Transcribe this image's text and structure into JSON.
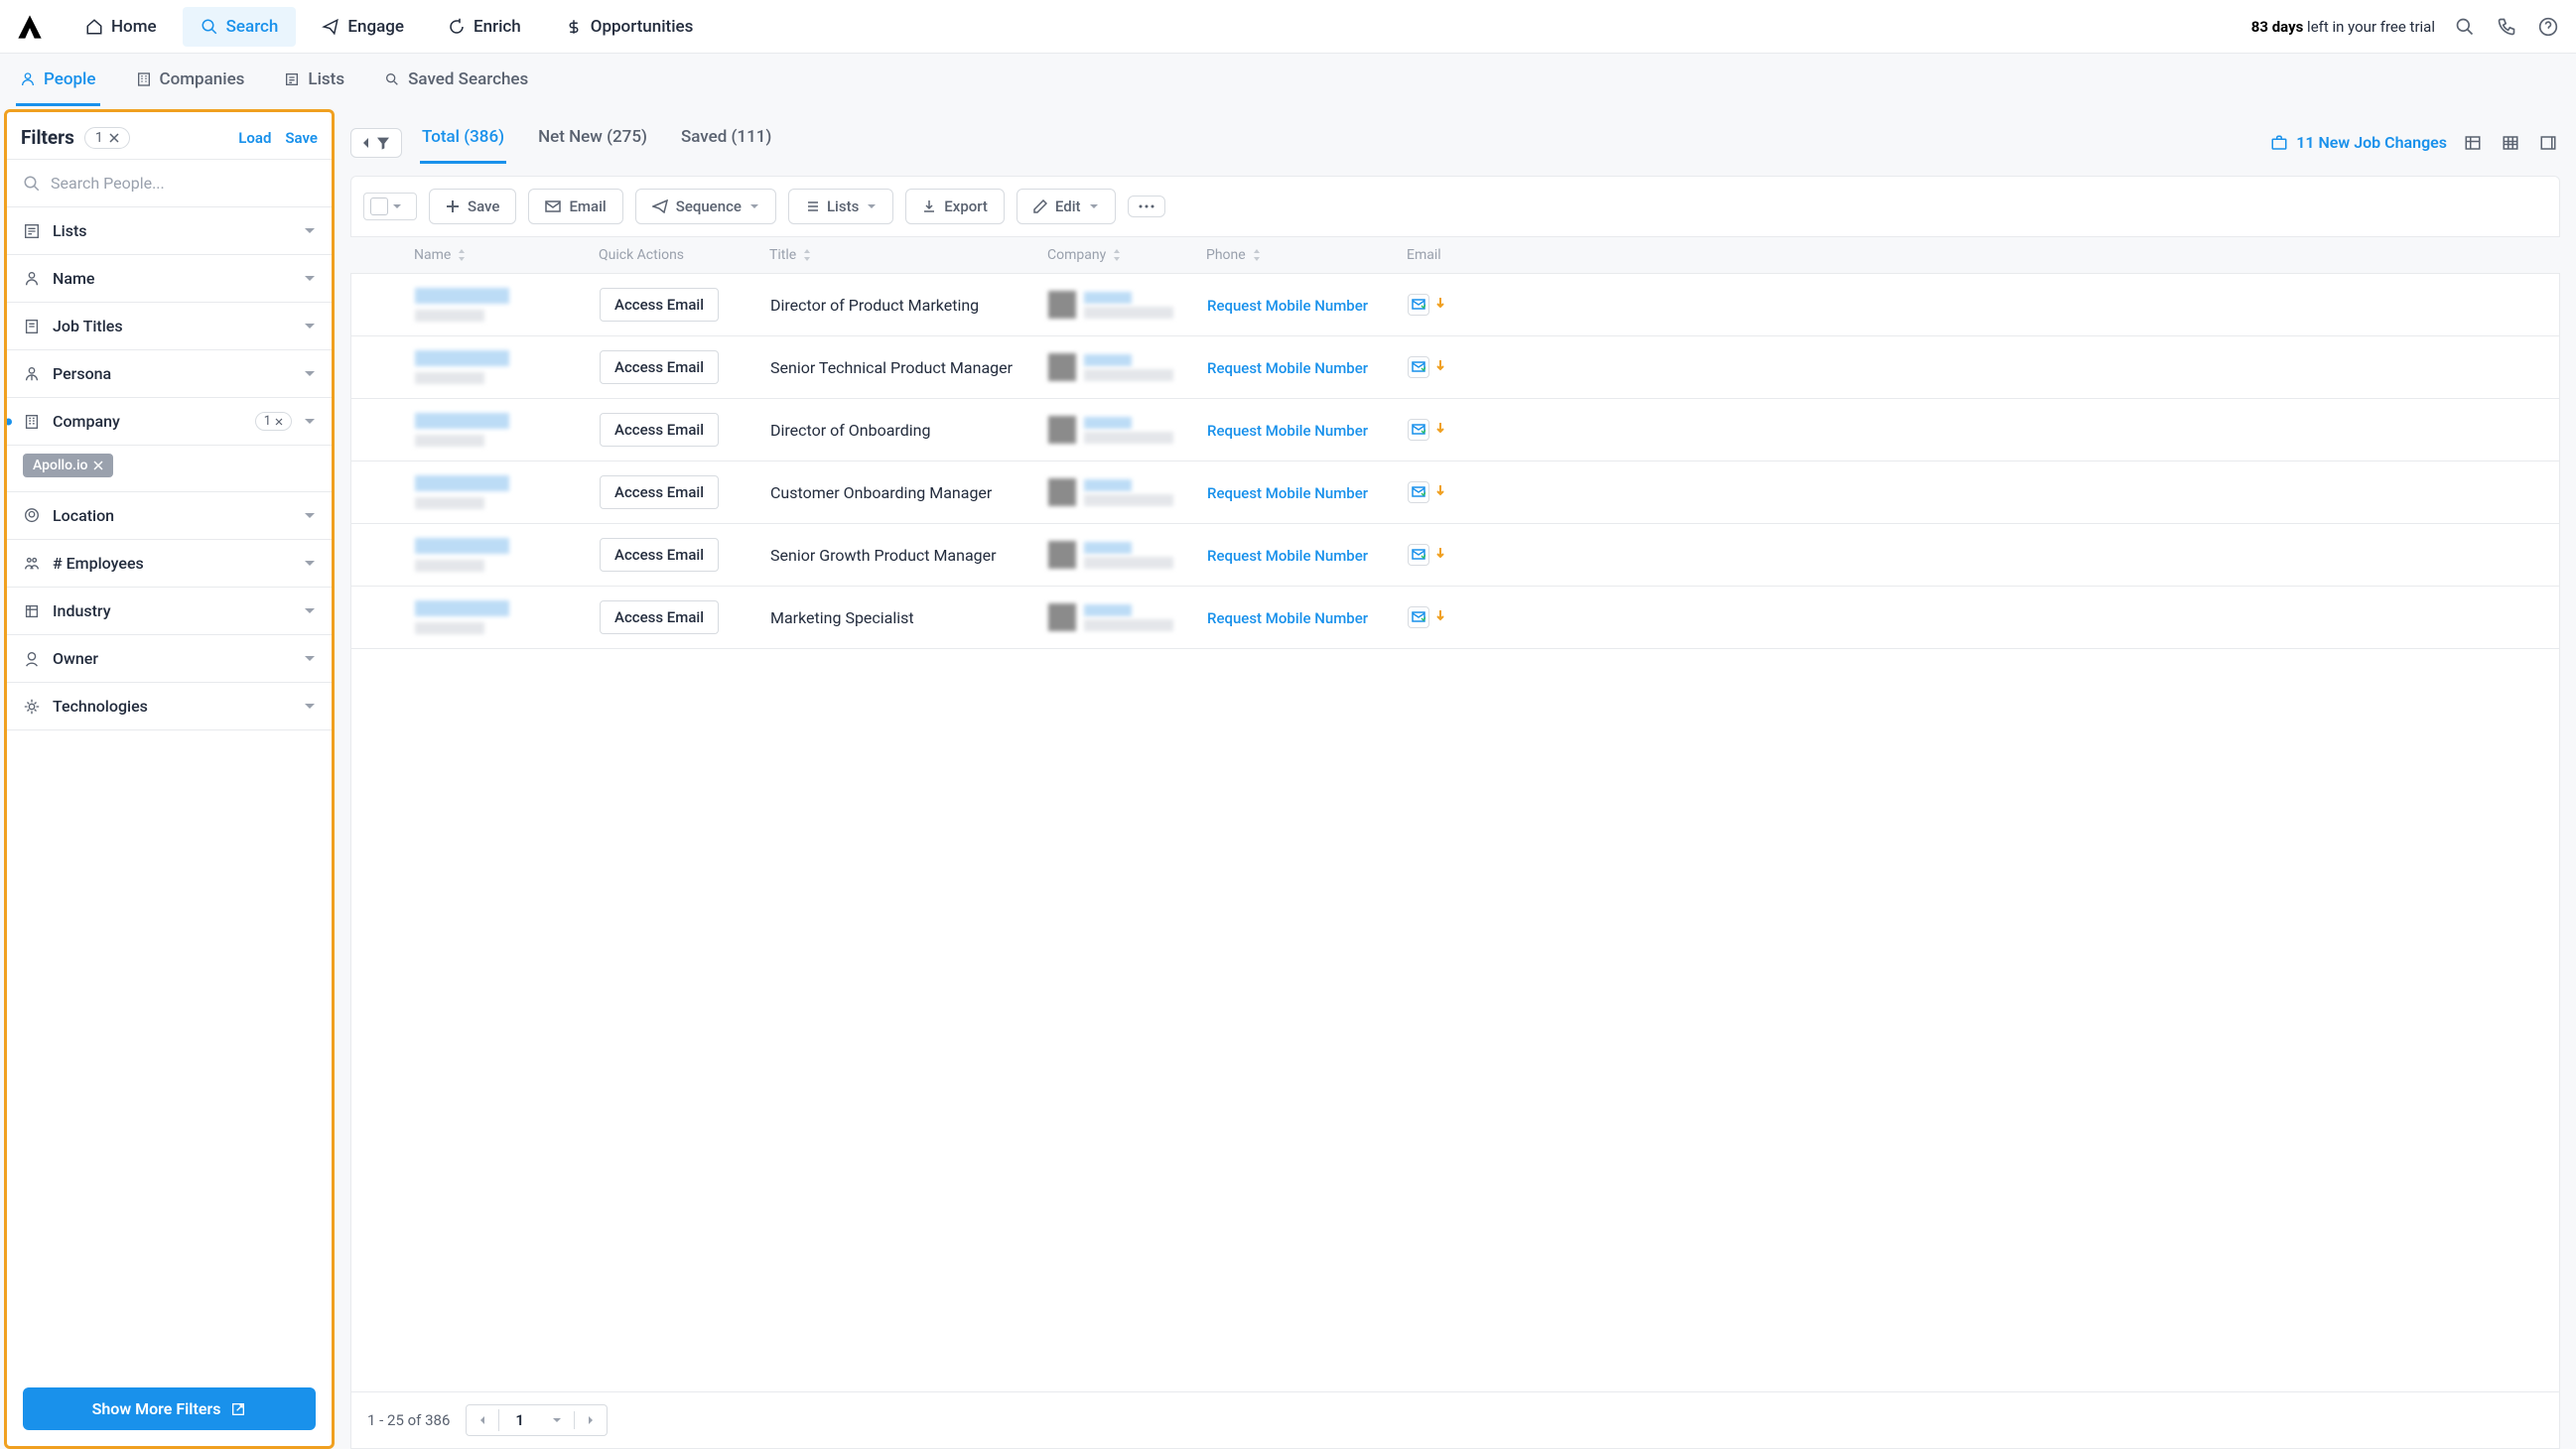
{
  "nav": {
    "items": [
      {
        "label": "Home"
      },
      {
        "label": "Search"
      },
      {
        "label": "Engage"
      },
      {
        "label": "Enrich"
      },
      {
        "label": "Opportunities"
      }
    ],
    "trial_days": "83 days",
    "trial_suffix": " left in your free trial"
  },
  "subnav": {
    "items": [
      {
        "label": "People"
      },
      {
        "label": "Companies"
      },
      {
        "label": "Lists"
      },
      {
        "label": "Saved Searches"
      }
    ]
  },
  "filters": {
    "title": "Filters",
    "count": "1",
    "load": "Load",
    "save": "Save",
    "search_placeholder": "Search People...",
    "rows": [
      {
        "label": "Lists"
      },
      {
        "label": "Name"
      },
      {
        "label": "Job Titles"
      },
      {
        "label": "Persona"
      },
      {
        "label": "Company",
        "count": "1"
      },
      {
        "label": "Location"
      },
      {
        "label": "# Employees"
      },
      {
        "label": "Industry"
      },
      {
        "label": "Owner"
      },
      {
        "label": "Technologies"
      }
    ],
    "company_chip": "Apollo.io",
    "show_more": "Show More Filters"
  },
  "content": {
    "tabs": [
      {
        "label": "Total (386)"
      },
      {
        "label": "Net New (275)"
      },
      {
        "label": "Saved (111)"
      }
    ],
    "job_changes": "11 New Job Changes",
    "toolbar": {
      "save": "Save",
      "email": "Email",
      "sequence": "Sequence",
      "lists": "Lists",
      "export": "Export",
      "edit": "Edit"
    },
    "columns": {
      "name": "Name",
      "qa": "Quick Actions",
      "title": "Title",
      "company": "Company",
      "phone": "Phone",
      "email": "Email"
    },
    "access_email": "Access Email",
    "request_mobile": "Request Mobile Number",
    "rows": [
      {
        "title": "Director of Product Marketing"
      },
      {
        "title": "Senior Technical Product Manager"
      },
      {
        "title": "Director of Onboarding"
      },
      {
        "title": "Customer Onboarding Manager"
      },
      {
        "title": "Senior Growth Product Manager"
      },
      {
        "title": "Marketing Specialist"
      }
    ],
    "pager": {
      "summary": "1 - 25 of 386",
      "page": "1"
    }
  }
}
